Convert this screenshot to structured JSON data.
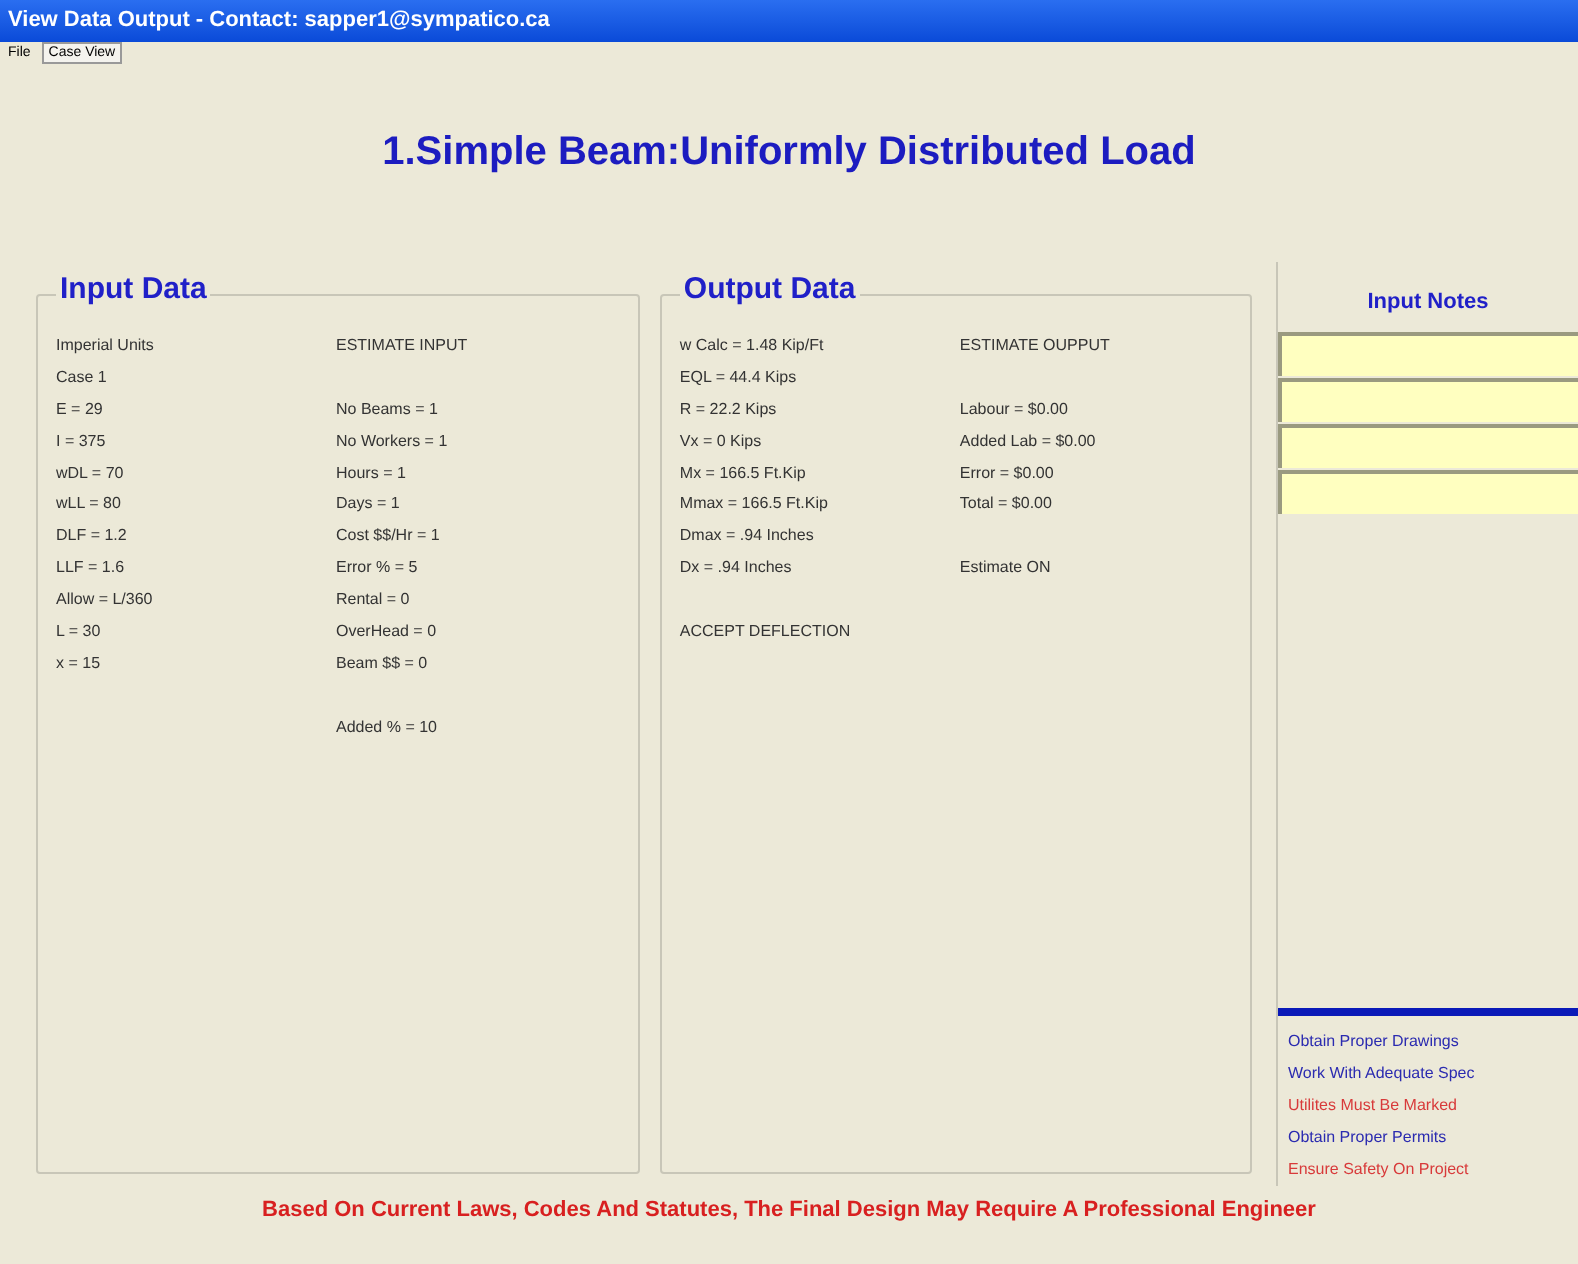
{
  "window": {
    "title": "View Data Output - Contact: sapper1@sympatico.ca"
  },
  "menu": [
    "File",
    "Case View"
  ],
  "heading": "1.Simple Beam:Uniformly Distributed Load",
  "input_data": {
    "title": "Input Data",
    "rows": [
      {
        "left": "Imperial Units",
        "right": "ESTIMATE INPUT"
      },
      {
        "left": "Case 1"
      },
      {
        "left": "E = 29",
        "right": "No Beams = 1"
      },
      {
        "left": "I = 375",
        "right": "No Workers = 1"
      },
      {
        "left": "wDL = 70",
        "right": "Hours = 1"
      },
      {
        "left": "wLL = 80",
        "right": "Days = 1"
      },
      {
        "left": "DLF = 1.2",
        "right": "Cost $$/Hr = 1"
      },
      {
        "left": "LLF = 1.6",
        "right": "Error % = 5"
      },
      {
        "left": "Allow = L/360",
        "right": "Rental = 0"
      },
      {
        "left": "L = 30",
        "right": "OverHead = 0"
      },
      {
        "left": "x = 15",
        "right": "Beam $$ = 0"
      },
      {},
      {
        "right": "Added % = 10"
      }
    ]
  },
  "output_data": {
    "title": "Output Data",
    "rows": [
      {
        "left": "w Calc = 1.48 Kip/Ft",
        "right": "ESTIMATE OUPPUT"
      },
      {
        "left": "EQL = 44.4 Kips"
      },
      {
        "left": "R = 22.2 Kips",
        "right": "Labour = $0.00"
      },
      {
        "left": "Vx = 0 Kips",
        "right": "Added Lab = $0.00"
      },
      {
        "left": "Mx = 166.5 Ft.Kip",
        "right": "Error = $0.00"
      },
      {
        "left": "Mmax = 166.5 Ft.Kip",
        "right": "Total = $0.00"
      },
      {
        "left": "Dmax = .94 Inches"
      },
      {
        "left": "Dx = .94 Inches",
        "right": "Estimate ON"
      },
      {},
      {
        "left": "ACCEPT DEFLECTION"
      }
    ]
  },
  "input_notes": {
    "title": "Input Notes"
  },
  "notes": [
    {
      "text": "Obtain Proper Drawings",
      "color": "#2b2bb0"
    },
    {
      "text": "Work With Adequate  Spec",
      "color": "#2b2bb0"
    },
    {
      "text": "Utilites Must Be Marked",
      "color": "#d83a3a"
    },
    {
      "text": "Obtain Proper Permits",
      "color": "#2b2bb0"
    },
    {
      "text": "Ensure Safety On Project",
      "color": "#d83a3a"
    }
  ],
  "footer": "Based On Current Laws, Codes And Statutes, The Final Design May Require A Professional Engineer"
}
